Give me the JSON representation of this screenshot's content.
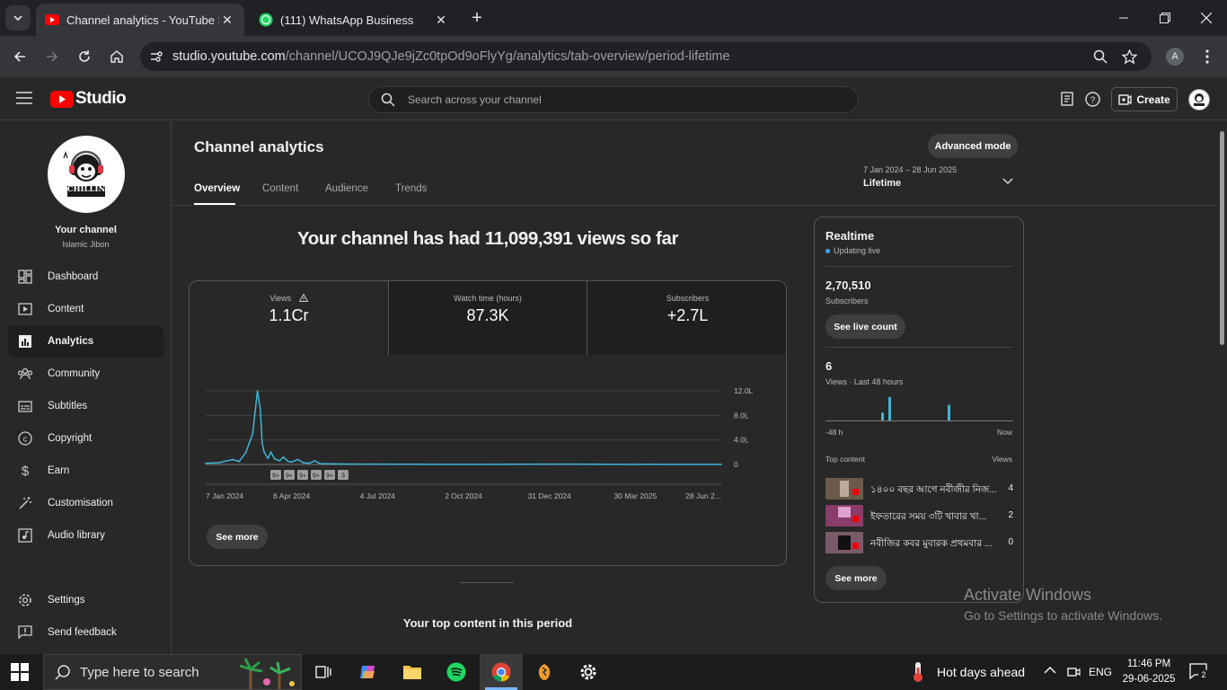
{
  "browser": {
    "tabs": [
      {
        "title": "Channel analytics - YouTube Studio",
        "active": true
      },
      {
        "title": "(111) WhatsApp Business",
        "active": false
      }
    ],
    "url_host": "studio.youtube.com",
    "url_path": "/channel/UCOJ9QJe9jZc0tpOd9oFlyYg/analytics/tab-overview/period-lifetime",
    "profile_initial": "A"
  },
  "header": {
    "logo_text": "Studio",
    "search_placeholder": "Search across your channel",
    "create_label": "Create"
  },
  "channel": {
    "label": "Your channel",
    "name": "Islamic Jibon",
    "avatar_text": "CHILLIN"
  },
  "sidebar": {
    "items": [
      {
        "label": "Dashboard",
        "icon": "dashboard-icon"
      },
      {
        "label": "Content",
        "icon": "content-icon"
      },
      {
        "label": "Analytics",
        "icon": "analytics-icon",
        "active": true
      },
      {
        "label": "Community",
        "icon": "community-icon"
      },
      {
        "label": "Subtitles",
        "icon": "subtitles-icon"
      },
      {
        "label": "Copyright",
        "icon": "copyright-icon"
      },
      {
        "label": "Earn",
        "icon": "earn-icon"
      },
      {
        "label": "Customisation",
        "icon": "customisation-icon"
      },
      {
        "label": "Audio library",
        "icon": "audio-library-icon"
      }
    ],
    "bottom_items": [
      {
        "label": "Settings",
        "icon": "settings-icon"
      },
      {
        "label": "Send feedback",
        "icon": "feedback-icon"
      }
    ]
  },
  "page": {
    "title": "Channel analytics",
    "advanced_mode_label": "Advanced mode",
    "tabs": [
      "Overview",
      "Content",
      "Audience",
      "Trends"
    ],
    "period_range": "7 Jan 2024 – 28 Jun 2025",
    "period_label": "Lifetime",
    "headline": "Your channel has had 11,099,391 views so far",
    "metrics": [
      {
        "label": "Views",
        "value": "1.1Cr",
        "warning": true
      },
      {
        "label": "Watch time (hours)",
        "value": "87.3K"
      },
      {
        "label": "Subscribers",
        "value": "+2.7L"
      }
    ],
    "see_more_label": "See more",
    "top_content_heading": "Your top content in this period"
  },
  "chart_data": {
    "type": "line",
    "x_tick_labels": [
      "7 Jan 2024",
      "6 Apr 2024",
      "4 Jul 2024",
      "2 Oct 2024",
      "31 Dec 2024",
      "30 Mar 2025",
      "28 Jun 2..."
    ],
    "y_tick_labels": [
      "12.0L",
      "8.0L",
      "4.0L",
      "0"
    ],
    "ylim": [
      0,
      1200000
    ],
    "x": [
      "2024-01-07",
      "2024-01-21",
      "2024-02-04",
      "2024-02-11",
      "2024-02-18",
      "2024-02-25",
      "2024-03-01",
      "2024-03-04",
      "2024-03-06",
      "2024-03-08",
      "2024-03-10",
      "2024-03-12",
      "2024-03-15",
      "2024-03-19",
      "2024-03-24",
      "2024-03-28",
      "2024-04-02",
      "2024-04-06",
      "2024-04-12",
      "2024-04-18",
      "2024-04-24",
      "2024-04-30",
      "2024-05-05",
      "2024-05-15",
      "2024-06-01",
      "2024-07-01",
      "2024-09-01",
      "2024-11-01",
      "2025-01-01",
      "2025-03-01",
      "2025-05-01",
      "2025-06-28"
    ],
    "values": [
      20000,
      30000,
      80000,
      50000,
      200000,
      500000,
      1200000,
      900000,
      350000,
      200000,
      150000,
      100000,
      200000,
      90000,
      60000,
      120000,
      50000,
      40000,
      80000,
      30000,
      20000,
      60000,
      15000,
      12000,
      8000,
      6000,
      5000,
      4000,
      6000,
      3000,
      2000,
      1000
    ],
    "annotations": [
      "9+",
      "9+",
      "9+",
      "9+",
      "9+",
      "3"
    ],
    "grid": true
  },
  "realtime": {
    "title": "Realtime",
    "status": "Updating live",
    "subscribers_value": "2,70,510",
    "subscribers_label": "Subscribers",
    "see_live_label": "See live count",
    "views_value": "6",
    "views_label": "Views · Last 48 hours",
    "axis_start": "-48 h",
    "axis_end": "Now",
    "bars": [
      1,
      3,
      2
    ],
    "top_content_label": "Top content",
    "top_views_label": "Views",
    "items": [
      {
        "title": "১৪০০ বছর আগে নবীজীর নিজ...",
        "views": "4"
      },
      {
        "title": "ইফতারের সময় ৩টি খাবার খা...",
        "views": "2"
      },
      {
        "title": "নবীজির কবর মুবারক প্রথমবার ...",
        "views": "0"
      }
    ],
    "see_more_label": "See more"
  },
  "watermark": {
    "line1": "Activate Windows",
    "line2": "Go to Settings to activate Windows."
  },
  "taskbar": {
    "search_placeholder": "Type here to search",
    "weather": "Hot days ahead",
    "lang": "ENG",
    "time": "11:46 PM",
    "date": "29-06-2025",
    "notifications": "2"
  },
  "colors": {
    "accent": "#3ea6ff",
    "chart_line": "#41b4d7",
    "youtube_red": "#ff0000"
  }
}
